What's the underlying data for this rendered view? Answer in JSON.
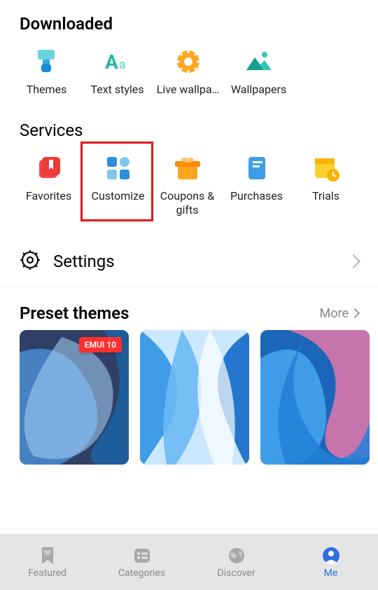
{
  "sections": {
    "downloaded": {
      "title": "Downloaded",
      "items": [
        {
          "label": "Themes",
          "icon": "brush"
        },
        {
          "label": "Text styles",
          "icon": "aa"
        },
        {
          "label": "Live wallpa…",
          "icon": "gear-sun"
        },
        {
          "label": "Wallpapers",
          "icon": "mountain"
        }
      ]
    },
    "services": {
      "title": "Services",
      "items": [
        {
          "label": "Favorites",
          "icon": "bookmark",
          "highlight": false
        },
        {
          "label": "Customize",
          "icon": "grid",
          "highlight": true
        },
        {
          "label": "Coupons & gifts",
          "icon": "gift",
          "highlight": false
        },
        {
          "label": "Purchases",
          "icon": "receipt",
          "highlight": false
        },
        {
          "label": "Trials",
          "icon": "calendar-clock",
          "highlight": false
        }
      ]
    }
  },
  "settings": {
    "label": "Settings"
  },
  "preset": {
    "title": "Preset themes",
    "more": "More",
    "themes": [
      {
        "badge": "EMUI 10"
      },
      {
        "badge": null
      },
      {
        "badge": null
      }
    ]
  },
  "nav": {
    "items": [
      {
        "label": "Featured",
        "icon": "heart-tag",
        "active": false
      },
      {
        "label": "Categories",
        "icon": "list",
        "active": false
      },
      {
        "label": "Discover",
        "icon": "globe",
        "active": false
      },
      {
        "label": "Me",
        "icon": "person",
        "active": true
      }
    ]
  }
}
